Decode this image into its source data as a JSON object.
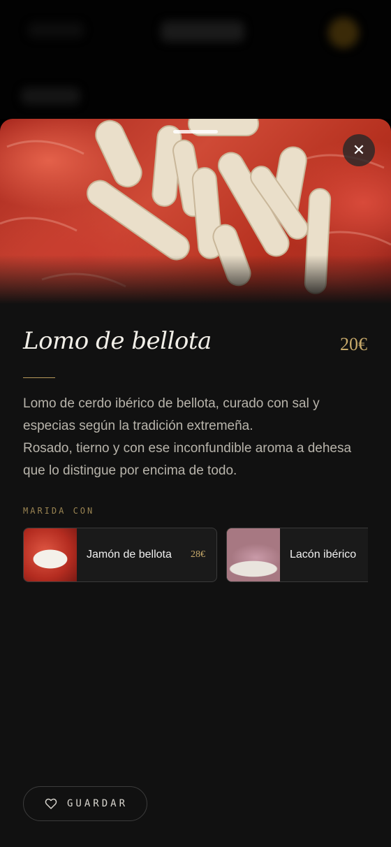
{
  "dish": {
    "title": "Lomo de bellota",
    "price": "20€",
    "description": [
      "Lomo de cerdo ibérico de bellota, curado con sal y especias según la tradición extremeña.",
      "Rosado, tierno y con ese inconfundible aroma a dehesa que lo distingue por encima de todo."
    ]
  },
  "pairings": {
    "label": "MARIDA CON",
    "items": [
      {
        "name": "Jamón de bellota",
        "price": "28€"
      },
      {
        "name": "Lacón ibérico",
        "price": ""
      }
    ]
  },
  "actions": {
    "close_icon": "close-icon",
    "save_icon": "heart-icon",
    "save_label": "GUARDAR"
  },
  "colors": {
    "background": "#111111",
    "accent_gold": "#c7a96a",
    "text_light": "#f2efe8",
    "text_muted": "#b8b4ab"
  }
}
